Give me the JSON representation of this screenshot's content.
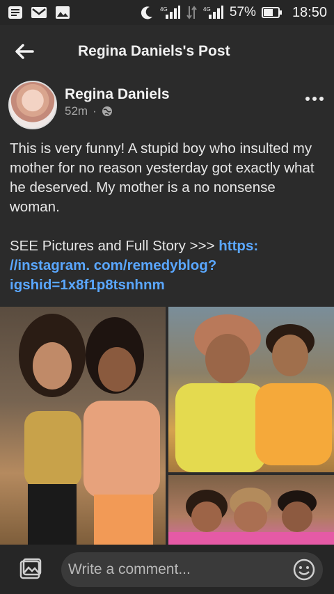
{
  "status_bar": {
    "battery_percent": "57%",
    "time": "18:50",
    "icons": [
      "notes-icon",
      "mail-icon",
      "image-icon",
      "moon-icon",
      "signal-icon",
      "data-icon",
      "signal-icon",
      "battery-icon"
    ]
  },
  "header": {
    "title": "Regina Daniels's Post",
    "back_icon": "back-arrow-icon"
  },
  "post": {
    "author": "Regina Daniels",
    "time": "52m",
    "separator": "·",
    "privacy_icon": "globe-icon",
    "paragraph1": "This is very funny! A stupid boy who insulted my mother for no reason yesterday got exactly what he deserved. My mother is a no nonsense woman.",
    "paragraph2_prefix": "SEE Pictures and Full Story >>> ",
    "link": "https://instagram.com/remedyblog?igshid=1x8f1p8tsnhnm",
    "link_display": "https: //instagram. com/remedyblog?igshid=1x8f1p8tsnhnm"
  },
  "photos": [
    {
      "name": "photo-two-women"
    },
    {
      "name": "photo-mother-daughter"
    },
    {
      "name": "photo-family-group"
    }
  ],
  "comment_bar": {
    "placeholder": "Write a comment...",
    "left_icon": "gallery-icon",
    "right_icon": "emoji-icon"
  }
}
